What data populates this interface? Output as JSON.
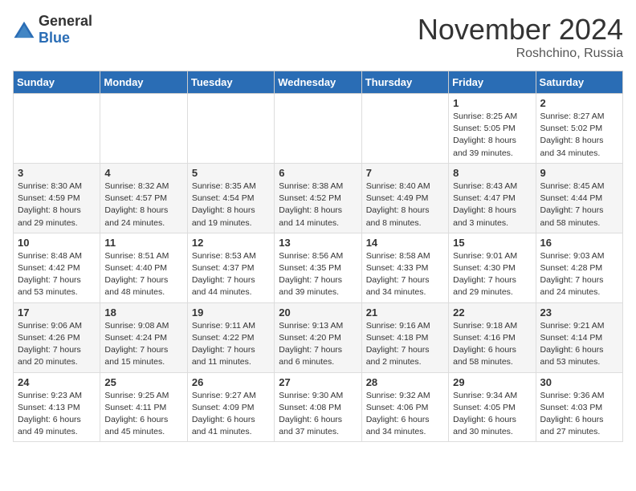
{
  "logo": {
    "general": "General",
    "blue": "Blue"
  },
  "title": "November 2024",
  "location": "Roshchino, Russia",
  "days_of_week": [
    "Sunday",
    "Monday",
    "Tuesday",
    "Wednesday",
    "Thursday",
    "Friday",
    "Saturday"
  ],
  "weeks": [
    [
      {
        "day": "",
        "info": ""
      },
      {
        "day": "",
        "info": ""
      },
      {
        "day": "",
        "info": ""
      },
      {
        "day": "",
        "info": ""
      },
      {
        "day": "",
        "info": ""
      },
      {
        "day": "1",
        "info": "Sunrise: 8:25 AM\nSunset: 5:05 PM\nDaylight: 8 hours and 39 minutes."
      },
      {
        "day": "2",
        "info": "Sunrise: 8:27 AM\nSunset: 5:02 PM\nDaylight: 8 hours and 34 minutes."
      }
    ],
    [
      {
        "day": "3",
        "info": "Sunrise: 8:30 AM\nSunset: 4:59 PM\nDaylight: 8 hours and 29 minutes."
      },
      {
        "day": "4",
        "info": "Sunrise: 8:32 AM\nSunset: 4:57 PM\nDaylight: 8 hours and 24 minutes."
      },
      {
        "day": "5",
        "info": "Sunrise: 8:35 AM\nSunset: 4:54 PM\nDaylight: 8 hours and 19 minutes."
      },
      {
        "day": "6",
        "info": "Sunrise: 8:38 AM\nSunset: 4:52 PM\nDaylight: 8 hours and 14 minutes."
      },
      {
        "day": "7",
        "info": "Sunrise: 8:40 AM\nSunset: 4:49 PM\nDaylight: 8 hours and 8 minutes."
      },
      {
        "day": "8",
        "info": "Sunrise: 8:43 AM\nSunset: 4:47 PM\nDaylight: 8 hours and 3 minutes."
      },
      {
        "day": "9",
        "info": "Sunrise: 8:45 AM\nSunset: 4:44 PM\nDaylight: 7 hours and 58 minutes."
      }
    ],
    [
      {
        "day": "10",
        "info": "Sunrise: 8:48 AM\nSunset: 4:42 PM\nDaylight: 7 hours and 53 minutes."
      },
      {
        "day": "11",
        "info": "Sunrise: 8:51 AM\nSunset: 4:40 PM\nDaylight: 7 hours and 48 minutes."
      },
      {
        "day": "12",
        "info": "Sunrise: 8:53 AM\nSunset: 4:37 PM\nDaylight: 7 hours and 44 minutes."
      },
      {
        "day": "13",
        "info": "Sunrise: 8:56 AM\nSunset: 4:35 PM\nDaylight: 7 hours and 39 minutes."
      },
      {
        "day": "14",
        "info": "Sunrise: 8:58 AM\nSunset: 4:33 PM\nDaylight: 7 hours and 34 minutes."
      },
      {
        "day": "15",
        "info": "Sunrise: 9:01 AM\nSunset: 4:30 PM\nDaylight: 7 hours and 29 minutes."
      },
      {
        "day": "16",
        "info": "Sunrise: 9:03 AM\nSunset: 4:28 PM\nDaylight: 7 hours and 24 minutes."
      }
    ],
    [
      {
        "day": "17",
        "info": "Sunrise: 9:06 AM\nSunset: 4:26 PM\nDaylight: 7 hours and 20 minutes."
      },
      {
        "day": "18",
        "info": "Sunrise: 9:08 AM\nSunset: 4:24 PM\nDaylight: 7 hours and 15 minutes."
      },
      {
        "day": "19",
        "info": "Sunrise: 9:11 AM\nSunset: 4:22 PM\nDaylight: 7 hours and 11 minutes."
      },
      {
        "day": "20",
        "info": "Sunrise: 9:13 AM\nSunset: 4:20 PM\nDaylight: 7 hours and 6 minutes."
      },
      {
        "day": "21",
        "info": "Sunrise: 9:16 AM\nSunset: 4:18 PM\nDaylight: 7 hours and 2 minutes."
      },
      {
        "day": "22",
        "info": "Sunrise: 9:18 AM\nSunset: 4:16 PM\nDaylight: 6 hours and 58 minutes."
      },
      {
        "day": "23",
        "info": "Sunrise: 9:21 AM\nSunset: 4:14 PM\nDaylight: 6 hours and 53 minutes."
      }
    ],
    [
      {
        "day": "24",
        "info": "Sunrise: 9:23 AM\nSunset: 4:13 PM\nDaylight: 6 hours and 49 minutes."
      },
      {
        "day": "25",
        "info": "Sunrise: 9:25 AM\nSunset: 4:11 PM\nDaylight: 6 hours and 45 minutes."
      },
      {
        "day": "26",
        "info": "Sunrise: 9:27 AM\nSunset: 4:09 PM\nDaylight: 6 hours and 41 minutes."
      },
      {
        "day": "27",
        "info": "Sunrise: 9:30 AM\nSunset: 4:08 PM\nDaylight: 6 hours and 37 minutes."
      },
      {
        "day": "28",
        "info": "Sunrise: 9:32 AM\nSunset: 4:06 PM\nDaylight: 6 hours and 34 minutes."
      },
      {
        "day": "29",
        "info": "Sunrise: 9:34 AM\nSunset: 4:05 PM\nDaylight: 6 hours and 30 minutes."
      },
      {
        "day": "30",
        "info": "Sunrise: 9:36 AM\nSunset: 4:03 PM\nDaylight: 6 hours and 27 minutes."
      }
    ]
  ]
}
